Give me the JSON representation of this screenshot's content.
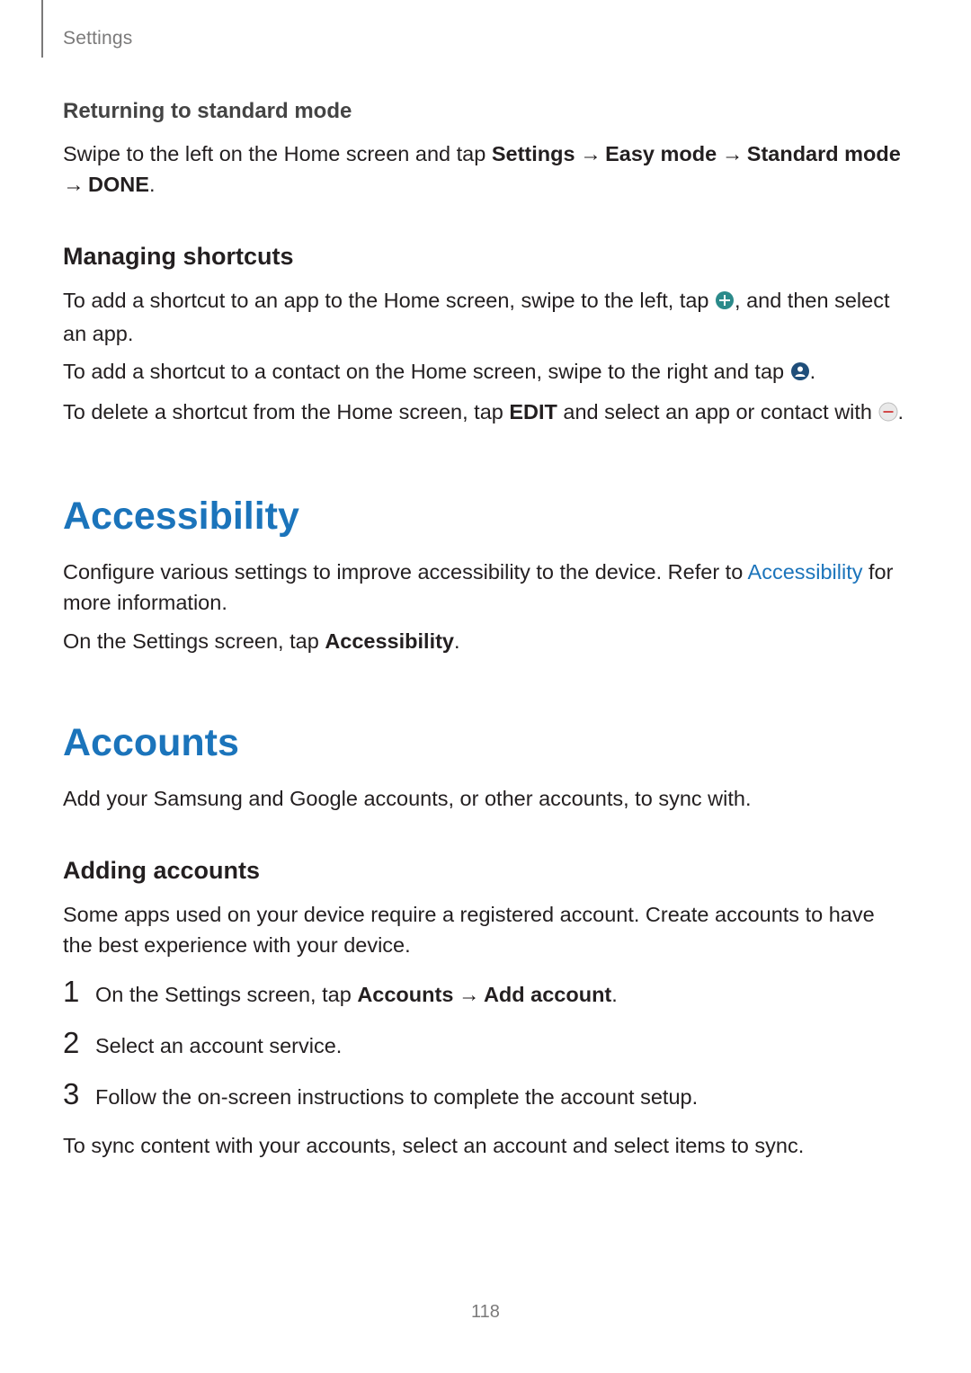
{
  "header": {
    "section": "Settings"
  },
  "returning": {
    "title": "Returning to standard mode",
    "p1a": "Swipe to the left on the Home screen and tap ",
    "p1_settings": "Settings",
    "p1_arrow1": " → ",
    "p1_easy": "Easy mode",
    "p1_arrow2": " → ",
    "p1_standard": "Standard mode",
    "p1_arrow3": " → ",
    "p1_done": "DONE",
    "p1_end": "."
  },
  "managing": {
    "title": "Managing shortcuts",
    "p1a": "To add a shortcut to an app to the Home screen, swipe to the left, tap ",
    "p1b": ", and then select an app.",
    "p2a": "To add a shortcut to a contact on the Home screen, swipe to the right and tap ",
    "p2b": ".",
    "p3a": "To delete a shortcut from the Home screen, tap ",
    "p3_edit": "EDIT",
    "p3b": " and select an app or contact with ",
    "p3c": "."
  },
  "accessibility": {
    "title": "Accessibility",
    "p1a": "Configure various settings to improve accessibility to the device. Refer to ",
    "p1_link": "Accessibility",
    "p1b": " for more information.",
    "p2a": "On the Settings screen, tap ",
    "p2_bold": "Accessibility",
    "p2b": "."
  },
  "accounts": {
    "title": "Accounts",
    "p1": "Add your Samsung and Google accounts, or other accounts, to sync with.",
    "adding_title": "Adding accounts",
    "p2": "Some apps used on your device require a registered account. Create accounts to have the best experience with your device.",
    "steps": {
      "s1_num": "1",
      "s1a": "On the Settings screen, tap ",
      "s1_accounts": "Accounts",
      "s1_arrow": " → ",
      "s1_add": "Add account",
      "s1_end": ".",
      "s2_num": "2",
      "s2": "Select an account service.",
      "s3_num": "3",
      "s3": "Follow the on-screen instructions to complete the account setup."
    },
    "p3": "To sync content with your accounts, select an account and select items to sync."
  },
  "page_number": "118"
}
